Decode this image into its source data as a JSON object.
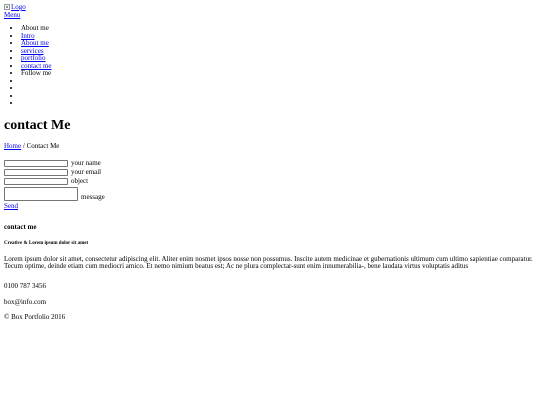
{
  "header": {
    "logo_alt": "Logo",
    "menu_label": "Menu"
  },
  "nav": {
    "items": [
      {
        "label": "About me",
        "link": false
      },
      {
        "label": "Intro",
        "link": true
      },
      {
        "label": "About me",
        "link": true
      },
      {
        "label": "services",
        "link": true
      },
      {
        "label": "portfolio",
        "link": true
      },
      {
        "label": "contact me",
        "link": true
      },
      {
        "label": "Follow me",
        "link": false
      }
    ],
    "social_icons": [
      "social-icon-1",
      "social-icon-2",
      "social-icon-3",
      "social-icon-4"
    ]
  },
  "page": {
    "title": "contact Me"
  },
  "breadcrumb": {
    "home": "Home",
    "separator": " / ",
    "current": "Contact Me"
  },
  "form": {
    "name_label": "your name",
    "email_label": "your email",
    "object_label": "object",
    "message_label": "message",
    "send_label": "Send",
    "name_value": "",
    "email_value": "",
    "object_value": "",
    "message_value": ""
  },
  "contact": {
    "heading": "contact me",
    "subheading": "Creative & Lorem ipsum dolor sit amet",
    "body": "Lorem ipsum dolor sit amet, consectetur adipiscing elit. Aliter enim nosmet ipsos nosse non possumus. Inscite autem medicinae et gubernationis ultimum cum ultimo sapientiae comparatur. Tecum optime, deinde etiam cum mediocri amico. Et nemo nimium beatus est; Ac ne plura complectar-sunt enim innumerabilia-, bene laudata virtus voluptatis aditus",
    "phone": "0100 787 3456",
    "email": "box@info.com"
  },
  "footer": {
    "copyright": "© Box Portfolio 2016"
  },
  "colors": {
    "link": "#0000ee",
    "text": "#000000",
    "background": "#ffffff"
  }
}
